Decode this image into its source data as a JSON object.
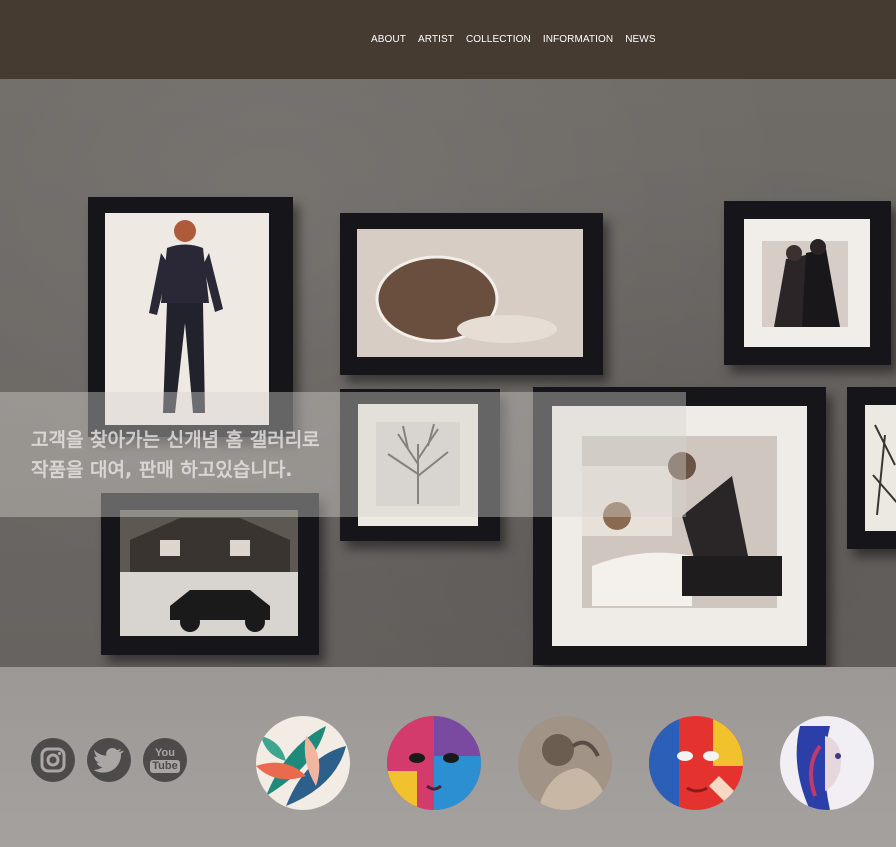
{
  "nav": {
    "items": [
      "ABOUT",
      "ARTIST",
      "COLLECTION",
      "INFORMATION",
      "NEWS"
    ]
  },
  "hero": {
    "caption_line1": "고객을 찾아가는 신개념 홈 갤러리로",
    "caption_line2": "작품을 대여, 판매 하고있습니다."
  },
  "social": {
    "icons": [
      "instagram-icon",
      "twitter-icon",
      "youtube-icon"
    ],
    "youtube_text_top": "You",
    "youtube_text_bottom": "Tube"
  },
  "gallery": {
    "thumbnails": [
      "tropical-leaves",
      "painted-face-colorful",
      "sepia-portrait",
      "painted-face-red",
      "watercolor-woman"
    ]
  },
  "colors": {
    "header_bg": "#463b30",
    "footer_bg": "#a09c99",
    "icon_bg": "#4d4b4a"
  }
}
